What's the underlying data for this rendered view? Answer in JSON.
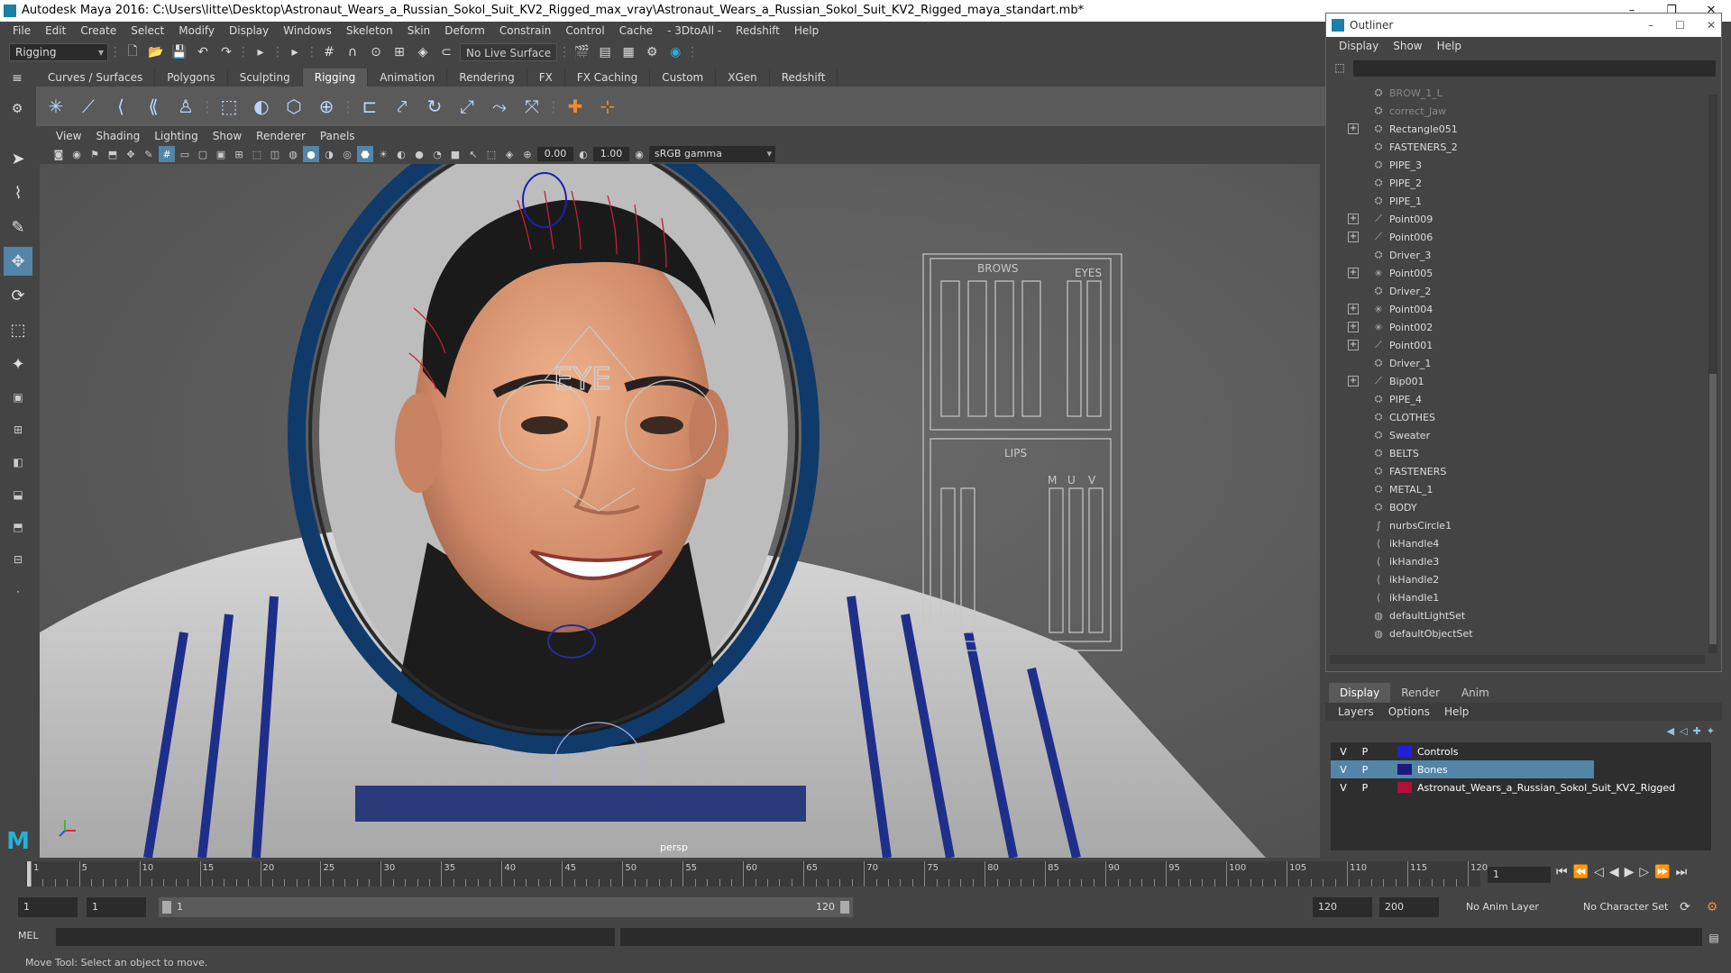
{
  "window": {
    "title": "Autodesk Maya 2016: C:\\Users\\litte\\Desktop\\Astronaut_Wears_a_Russian_Sokol_Suit_KV2_Rigged_max_vray\\Astronaut_Wears_a_Russian_Sokol_Suit_KV2_Rigged_maya_standart.mb*"
  },
  "menubar": [
    "File",
    "Edit",
    "Create",
    "Select",
    "Modify",
    "Display",
    "Windows",
    "Skeleton",
    "Skin",
    "Deform",
    "Constrain",
    "Control",
    "Cache",
    "- 3DtoAll -",
    "Redshift",
    "Help"
  ],
  "statusline": {
    "mode": "Rigging",
    "live_surface": "No Live Surface"
  },
  "shelf": {
    "tabs": [
      "Curves / Surfaces",
      "Polygons",
      "Sculpting",
      "Rigging",
      "Animation",
      "Rendering",
      "FX",
      "FX Caching",
      "Custom",
      "XGen",
      "Redshift"
    ],
    "active": "Rigging"
  },
  "viewport": {
    "menu": [
      "View",
      "Shading",
      "Lighting",
      "Show",
      "Renderer",
      "Panels"
    ],
    "exposure": "0.00",
    "gamma": "1.00",
    "color_space": "sRGB gamma",
    "camera": "persp",
    "controls_labels": {
      "brows": "BROWS",
      "eyes": "EYES",
      "lips": "LIPS",
      "m": "M",
      "u": "U",
      "v": "V",
      "eye": "EYE"
    }
  },
  "outliner": {
    "title": "Outliner",
    "menu": [
      "Display",
      "Show",
      "Help"
    ],
    "items": [
      {
        "name": "BROW_1_L",
        "icon": "mesh-icon",
        "expandable": false,
        "dim": true
      },
      {
        "name": "correct_Jaw",
        "icon": "mesh-icon",
        "expandable": false,
        "dim": true
      },
      {
        "name": "Rectangle051",
        "icon": "mesh-icon",
        "expandable": true,
        "dim": false
      },
      {
        "name": "FASTENERS_2",
        "icon": "mesh-icon",
        "expandable": false,
        "dim": false
      },
      {
        "name": "PIPE_3",
        "icon": "mesh-icon",
        "expandable": false,
        "dim": false
      },
      {
        "name": "PIPE_2",
        "icon": "mesh-icon",
        "expandable": false,
        "dim": false
      },
      {
        "name": "PIPE_1",
        "icon": "mesh-icon",
        "expandable": false,
        "dim": false
      },
      {
        "name": "Point009",
        "icon": "joint-icon",
        "expandable": true,
        "dim": false
      },
      {
        "name": "Point006",
        "icon": "joint-icon",
        "expandable": true,
        "dim": false
      },
      {
        "name": "Driver_3",
        "icon": "mesh-icon",
        "expandable": false,
        "dim": false
      },
      {
        "name": "Point005",
        "icon": "locator-icon",
        "expandable": true,
        "dim": false
      },
      {
        "name": "Driver_2",
        "icon": "mesh-icon",
        "expandable": false,
        "dim": false
      },
      {
        "name": "Point004",
        "icon": "locator-icon",
        "expandable": true,
        "dim": false
      },
      {
        "name": "Point002",
        "icon": "locator-icon",
        "expandable": true,
        "dim": false
      },
      {
        "name": "Point001",
        "icon": "joint-icon",
        "expandable": true,
        "dim": false
      },
      {
        "name": "Driver_1",
        "icon": "mesh-icon",
        "expandable": false,
        "dim": false
      },
      {
        "name": "Bip001",
        "icon": "joint-icon",
        "expandable": true,
        "dim": false
      },
      {
        "name": "PIPE_4",
        "icon": "mesh-icon",
        "expandable": false,
        "dim": false
      },
      {
        "name": "CLOTHES",
        "icon": "mesh-icon",
        "expandable": false,
        "dim": false
      },
      {
        "name": "Sweater",
        "icon": "mesh-icon",
        "expandable": false,
        "dim": false
      },
      {
        "name": "BELTS",
        "icon": "mesh-icon",
        "expandable": false,
        "dim": false
      },
      {
        "name": "FASTENERS",
        "icon": "mesh-icon",
        "expandable": false,
        "dim": false
      },
      {
        "name": "METAL_1",
        "icon": "mesh-icon",
        "expandable": false,
        "dim": false
      },
      {
        "name": "BODY",
        "icon": "mesh-icon",
        "expandable": false,
        "dim": false
      },
      {
        "name": "nurbsCircle1",
        "icon": "curve-icon",
        "expandable": false,
        "dim": false
      },
      {
        "name": "ikHandle4",
        "icon": "ik-icon",
        "expandable": false,
        "dim": false
      },
      {
        "name": "ikHandle3",
        "icon": "ik-icon",
        "expandable": false,
        "dim": false
      },
      {
        "name": "ikHandle2",
        "icon": "ik-icon",
        "expandable": false,
        "dim": false
      },
      {
        "name": "ikHandle1",
        "icon": "ik-icon",
        "expandable": false,
        "dim": false
      },
      {
        "name": "defaultLightSet",
        "icon": "set-icon",
        "expandable": false,
        "dim": false
      },
      {
        "name": "defaultObjectSet",
        "icon": "set-icon",
        "expandable": false,
        "dim": false
      }
    ]
  },
  "layers": {
    "tabs": [
      "Display",
      "Render",
      "Anim"
    ],
    "active": "Display",
    "menu": [
      "Layers",
      "Options",
      "Help"
    ],
    "rows": [
      {
        "v": "V",
        "p": "P",
        "color": "#1f1fe0",
        "name": "Controls",
        "selected": false
      },
      {
        "v": "V",
        "p": "P",
        "color": "#1a1a80",
        "name": "Bones",
        "selected": true
      },
      {
        "v": "V",
        "p": "P",
        "color": "#b0103a",
        "name": "Astronaut_Wears_a_Russian_Sokol_Suit_KV2_Rigged",
        "selected": false
      }
    ]
  },
  "timeline": {
    "ticks": [
      "1",
      "5",
      "10",
      "15",
      "20",
      "25",
      "30",
      "35",
      "40",
      "45",
      "50",
      "55",
      "60",
      "65",
      "70",
      "75",
      "80",
      "85",
      "90",
      "95",
      "100",
      "105",
      "110",
      "115",
      "120"
    ],
    "current_frame": "1"
  },
  "range": {
    "start": "1",
    "playback_start": "1",
    "slider_start": "1",
    "slider_end": "120",
    "playback_end": "120",
    "end": "200",
    "anim_layer": "No Anim Layer",
    "character_set": "No Character Set"
  },
  "command": {
    "label": "MEL"
  },
  "help_line": "Move Tool: Select an object to move."
}
